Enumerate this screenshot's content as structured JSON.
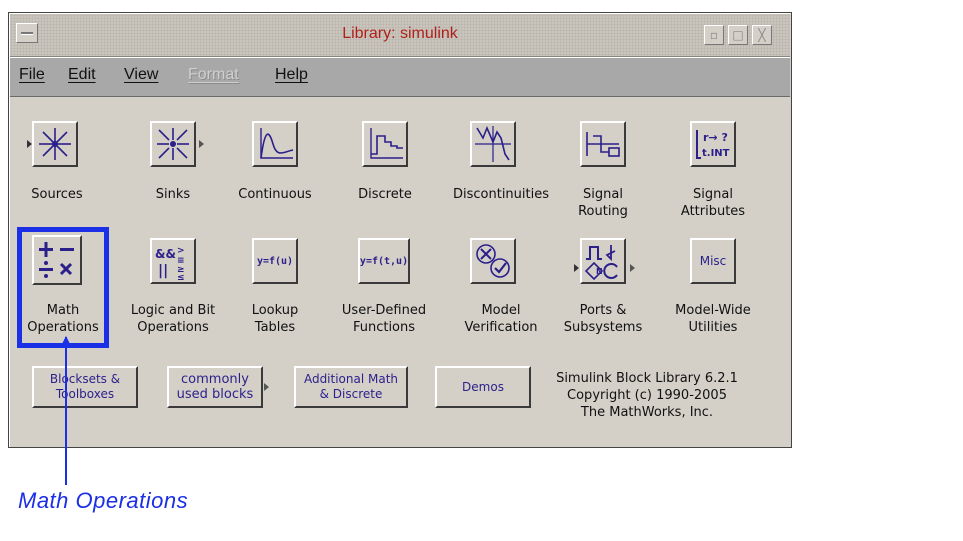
{
  "window": {
    "title": "Library: simulink"
  },
  "menubar": {
    "items": [
      {
        "label": "File",
        "disabled": false
      },
      {
        "label": "Edit",
        "disabled": false
      },
      {
        "label": "View",
        "disabled": false
      },
      {
        "label": "Format",
        "disabled": true
      },
      {
        "label": "Help",
        "disabled": false
      }
    ]
  },
  "blocks": {
    "row1": [
      {
        "label": "Sources"
      },
      {
        "label": "Sinks"
      },
      {
        "label": "Continuous"
      },
      {
        "label": "Discrete"
      },
      {
        "label": "Discontinuities"
      },
      {
        "label": "Signal\nRouting"
      },
      {
        "label": "Signal\nAttributes"
      }
    ],
    "row2": [
      {
        "label": "Math\nOperations"
      },
      {
        "label": "Logic and Bit\nOperations"
      },
      {
        "label": "Lookup\nTables",
        "icon_text": "y=f(u)"
      },
      {
        "label": "User-Defined\nFunctions",
        "icon_text": "y=f(t,u)"
      },
      {
        "label": "Model\nVerification"
      },
      {
        "label": "Ports &\nSubsystems"
      },
      {
        "label": "Model-Wide\nUtilities",
        "icon_text": "Misc"
      }
    ]
  },
  "buttons": [
    {
      "label": "Blocksets &\nToolboxes"
    },
    {
      "label": "commonly\nused blocks"
    },
    {
      "label": "Additional Math\n& Discrete"
    },
    {
      "label": "Demos"
    }
  ],
  "copyright": {
    "line1": "Simulink Block Library 6.2.1",
    "line2": "Copyright (c) 1990-2005",
    "line3": "The MathWorks, Inc."
  },
  "annotation": {
    "callout": "Math Operations",
    "color": "#1a2fe6"
  },
  "colors": {
    "title": "#b0201a",
    "block_text": "#2b1f8a"
  }
}
